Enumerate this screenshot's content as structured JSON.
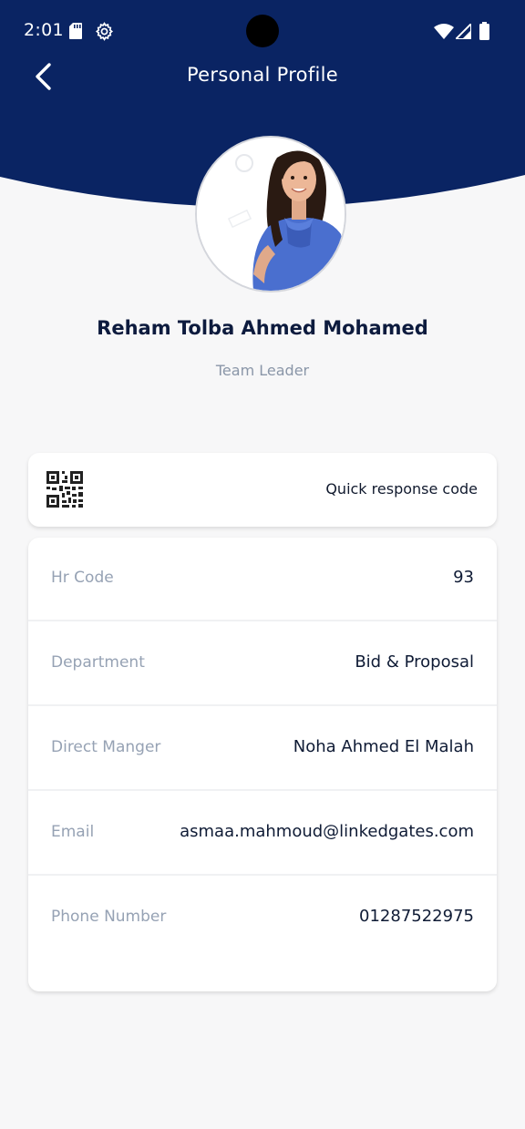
{
  "status_bar": {
    "time": "2:01",
    "icons": [
      "sd-card-icon",
      "gear-icon",
      "wifi-icon",
      "signal-icon",
      "battery-icon"
    ]
  },
  "header": {
    "title": "Personal Profile",
    "back_icon": "chevron-left-icon",
    "background_color": "#0a2463"
  },
  "profile": {
    "name": "Reham Tolba Ahmed Mohamed",
    "role": "Team Leader"
  },
  "qr_card": {
    "label": "Quick response code",
    "icon": "qr-code-icon"
  },
  "info": {
    "rows": [
      {
        "label": "Hr Code",
        "value": "93"
      },
      {
        "label": "Department",
        "value": "Bid & Proposal"
      },
      {
        "label": "Direct Manger",
        "value": "Noha Ahmed El Malah"
      },
      {
        "label": "Email",
        "value": "asmaa.mahmoud@linkedgates.com"
      },
      {
        "label": "Phone Number",
        "value": "01287522975"
      }
    ]
  },
  "colors": {
    "header_bg": "#0a2463",
    "page_bg": "#f7f7f8",
    "label_text": "#96a2b4",
    "value_text": "#0f1b35"
  }
}
